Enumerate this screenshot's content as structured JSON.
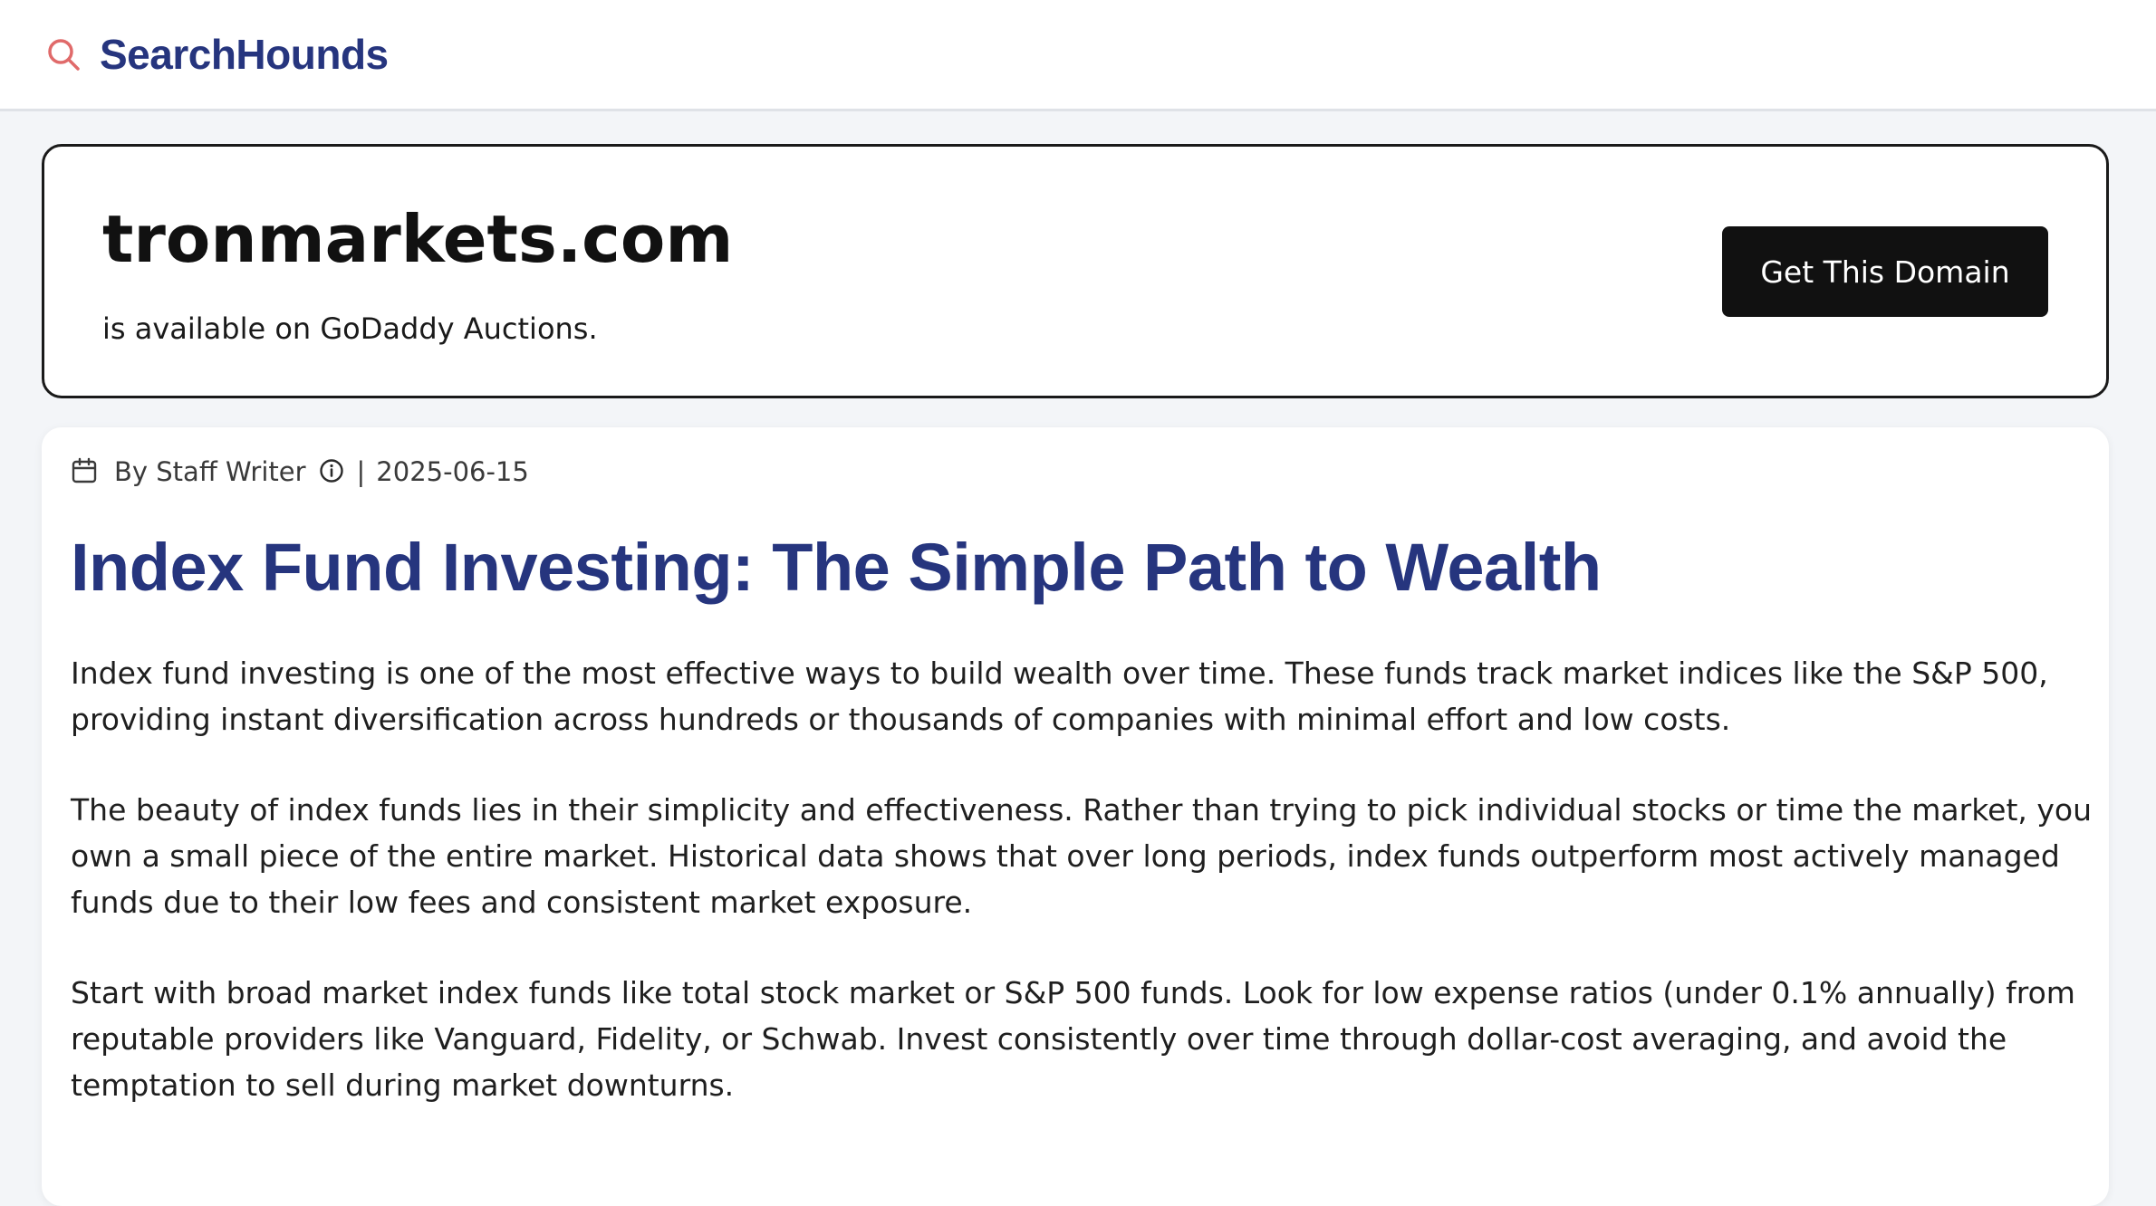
{
  "header": {
    "brand": "SearchHounds",
    "logo_icon": "search-icon",
    "logo_color": "#e06a6a",
    "brand_color": "#26357e"
  },
  "domain_banner": {
    "domain": "tronmarkets.com",
    "subtitle": "is available on GoDaddy Auctions.",
    "cta_label": "Get This Domain"
  },
  "article": {
    "meta": {
      "calendar_icon": "calendar-icon",
      "author": "By Staff Writer",
      "info_icon": "info-icon",
      "separator": "|",
      "date": "2025-06-15"
    },
    "title": "Index Fund Investing: The Simple Path to Wealth",
    "paragraphs": [
      "Index fund investing is one of the most effective ways to build wealth over time. These funds track market indices like the S&P 500, providing instant diversification across hundreds or thousands of companies with minimal effort and low costs.",
      "The beauty of index funds lies in their simplicity and effectiveness. Rather than trying to pick individual stocks or time the market, you own a small piece of the entire market. Historical data shows that over long periods, index funds outperform most actively managed funds due to their low fees and consistent market exposure.",
      "Start with broad market index funds like total stock market or S&P 500 funds. Look for low expense ratios (under 0.1% annually) from reputable providers like Vanguard, Fidelity, or Schwab. Invest consistently over time through dollar-cost averaging, and avoid the temptation to sell during market downturns."
    ]
  }
}
